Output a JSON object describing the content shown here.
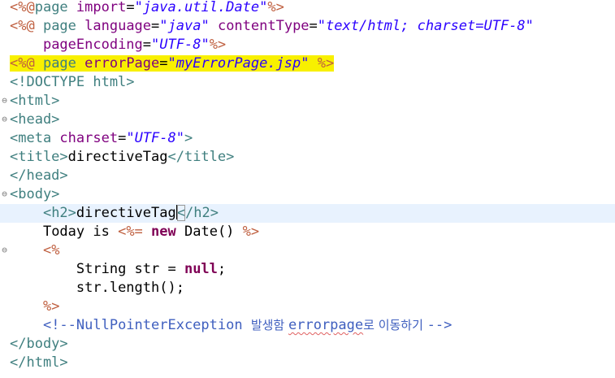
{
  "editor": {
    "lines": [
      {
        "segments": [
          {
            "t": "<%@",
            "c": "dir"
          },
          {
            "t": "page ",
            "c": "kw"
          },
          {
            "t": "import",
            "c": "attr"
          },
          {
            "t": "=",
            "c": ""
          },
          {
            "t": "\"java.util.Date\"",
            "c": "str"
          },
          {
            "t": "%>",
            "c": "dir"
          }
        ]
      },
      {
        "segments": [
          {
            "t": "<%@",
            "c": "dir"
          },
          {
            "t": " page ",
            "c": "kw"
          },
          {
            "t": "language",
            "c": "attr"
          },
          {
            "t": "=",
            "c": ""
          },
          {
            "t": "\"java\"",
            "c": "str"
          },
          {
            "t": " ",
            "c": ""
          },
          {
            "t": "contentType",
            "c": "attr"
          },
          {
            "t": "=",
            "c": ""
          },
          {
            "t": "\"text/html; charset=UTF-8\"",
            "c": "str"
          }
        ]
      },
      {
        "segments": [
          {
            "t": "    ",
            "c": ""
          },
          {
            "t": "pageEncoding",
            "c": "attr"
          },
          {
            "t": "=",
            "c": ""
          },
          {
            "t": "\"UTF-8\"",
            "c": "str"
          },
          {
            "t": "%>",
            "c": "dir"
          }
        ]
      },
      {
        "highlight": true,
        "segments": [
          {
            "t": "<%@",
            "c": "dir"
          },
          {
            "t": " page ",
            "c": "kw"
          },
          {
            "t": "errorPage",
            "c": "attr"
          },
          {
            "t": "=",
            "c": ""
          },
          {
            "t": "\"myErrorPage.jsp\"",
            "c": "str"
          },
          {
            "t": " ",
            "c": ""
          },
          {
            "t": "%>",
            "c": "dir"
          }
        ]
      },
      {
        "segments": [
          {
            "t": "<!DOCTYPE html>",
            "c": "tag"
          }
        ]
      },
      {
        "fold": true,
        "segments": [
          {
            "t": "<html>",
            "c": "tag"
          }
        ]
      },
      {
        "fold": true,
        "segments": [
          {
            "t": "<head>",
            "c": "tag"
          }
        ]
      },
      {
        "segments": [
          {
            "t": "<meta ",
            "c": "tag"
          },
          {
            "t": "charset",
            "c": "attr"
          },
          {
            "t": "=",
            "c": ""
          },
          {
            "t": "\"UTF-8\"",
            "c": "str"
          },
          {
            "t": ">",
            "c": "tag"
          }
        ]
      },
      {
        "segments": [
          {
            "t": "<title>",
            "c": "tag"
          },
          {
            "t": "directiveTag",
            "c": ""
          },
          {
            "t": "</title>",
            "c": "tag"
          }
        ]
      },
      {
        "segments": [
          {
            "t": "</head>",
            "c": "tag"
          }
        ]
      },
      {
        "fold": true,
        "segments": [
          {
            "t": "<body>",
            "c": "tag"
          }
        ]
      },
      {
        "current": true,
        "segments": [
          {
            "t": "    ",
            "c": ""
          },
          {
            "t": "<h2>",
            "c": "tag"
          },
          {
            "t": "directiveTag",
            "c": ""
          },
          {
            "t": "<",
            "c": "tag cursor-box",
            "caret": true
          },
          {
            "t": "/h2>",
            "c": "tag"
          }
        ]
      },
      {
        "segments": [
          {
            "t": "    ",
            "c": ""
          },
          {
            "t": "Today is ",
            "c": ""
          },
          {
            "t": "<%=",
            "c": "dir"
          },
          {
            "t": " ",
            "c": ""
          },
          {
            "t": "new",
            "c": "java-kw"
          },
          {
            "t": " Date() ",
            "c": ""
          },
          {
            "t": "%>",
            "c": "dir"
          }
        ]
      },
      {
        "fold": true,
        "segments": [
          {
            "t": "    ",
            "c": ""
          },
          {
            "t": "<%",
            "c": "dir"
          }
        ]
      },
      {
        "segments": [
          {
            "t": "        ",
            "c": ""
          },
          {
            "t": "String str = ",
            "c": ""
          },
          {
            "t": "null",
            "c": "java-kw"
          },
          {
            "t": ";",
            "c": ""
          }
        ]
      },
      {
        "segments": [
          {
            "t": "        ",
            "c": ""
          },
          {
            "t": "str.length();",
            "c": ""
          }
        ]
      },
      {
        "segments": [
          {
            "t": "    ",
            "c": ""
          },
          {
            "t": "%>",
            "c": "dir"
          }
        ]
      },
      {
        "segments": [
          {
            "t": "    ",
            "c": ""
          },
          {
            "t": "<!--NullPointerException ",
            "c": "cmt"
          },
          {
            "t": "발생함 ",
            "c": "cmt ko"
          },
          {
            "t": "errorpage",
            "c": "cmt squiggle"
          },
          {
            "t": "로 이동하기 ",
            "c": "cmt ko"
          },
          {
            "t": "-->",
            "c": "cmt"
          }
        ]
      },
      {
        "segments": [
          {
            "t": "</body>",
            "c": "tag"
          }
        ]
      },
      {
        "segments": [
          {
            "t": "</html>",
            "c": "tag"
          }
        ]
      }
    ]
  },
  "fold_icon": "collapse-minus-icon",
  "colors": {
    "directive": "#bf5f3f",
    "keyword": "#3f7f7f",
    "attribute": "#7f007f",
    "string": "#2a00ff",
    "comment": "#3f5fbf",
    "java_keyword": "#7f0055",
    "highlight": "#f8f000",
    "current_line": "#e8f2fe"
  }
}
